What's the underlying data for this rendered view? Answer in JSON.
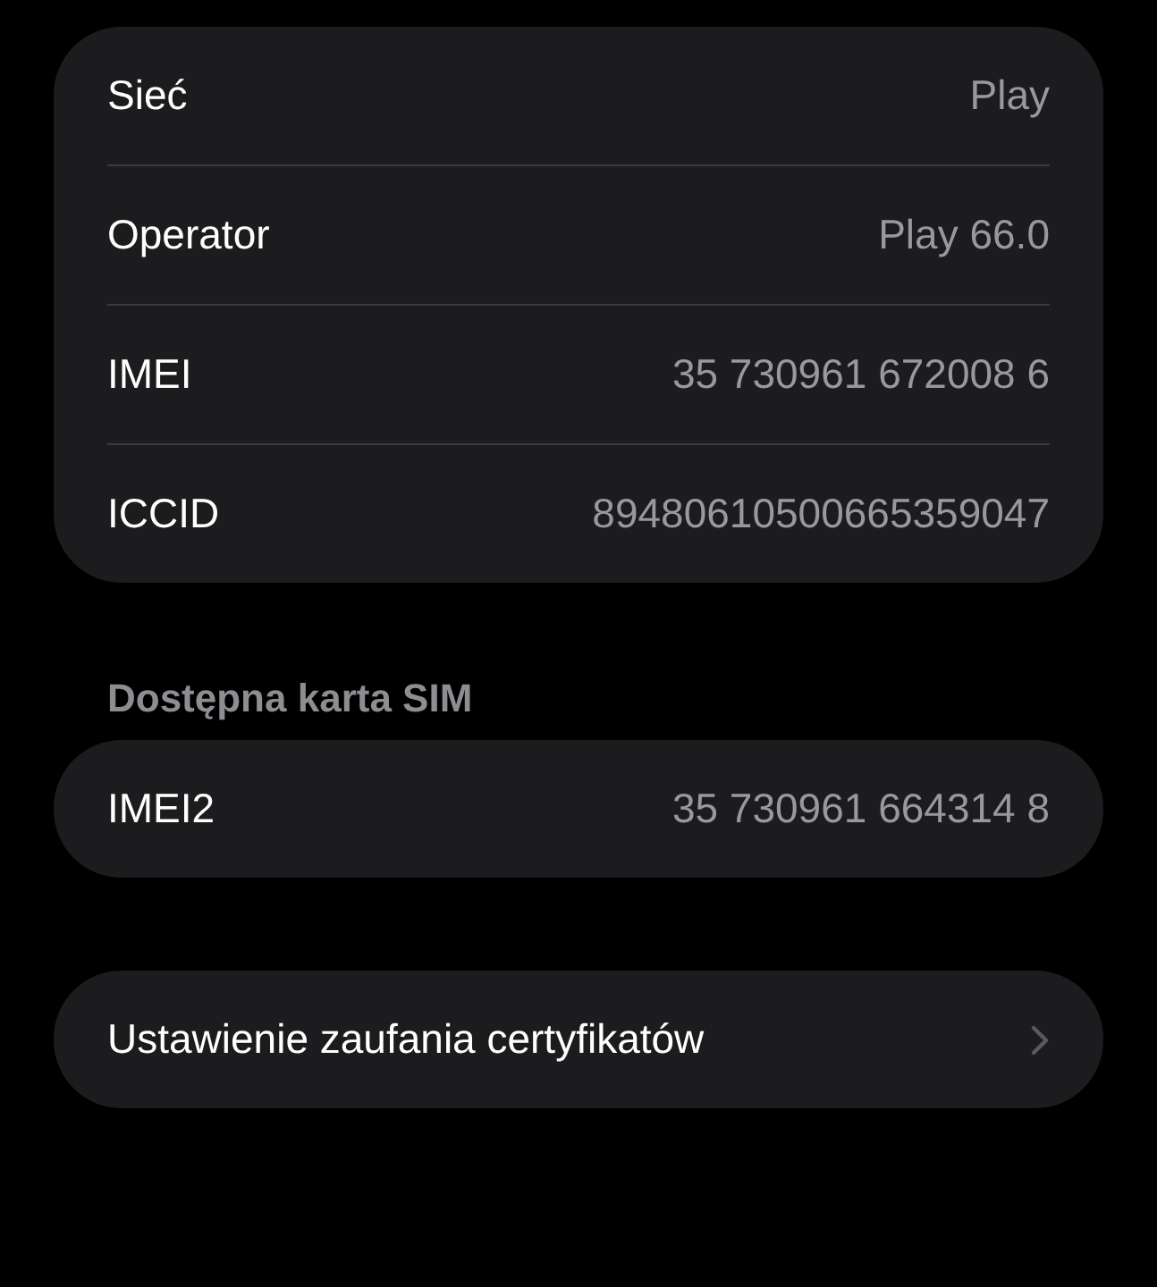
{
  "sections": [
    {
      "rows": [
        {
          "label": "Sieć",
          "value": "Play"
        },
        {
          "label": "Operator",
          "value": "Play 66.0"
        },
        {
          "label": "IMEI",
          "value": "35 730961 672008 6"
        },
        {
          "label": "ICCID",
          "value": "89480610500665359047"
        }
      ]
    },
    {
      "header": "Dostępna karta SIM",
      "rows": [
        {
          "label": "IMEI2",
          "value": "35 730961 664314 8"
        }
      ]
    },
    {
      "rows": [
        {
          "label": "Ustawienie zaufania certyfikatów",
          "kind": "link"
        }
      ]
    }
  ]
}
